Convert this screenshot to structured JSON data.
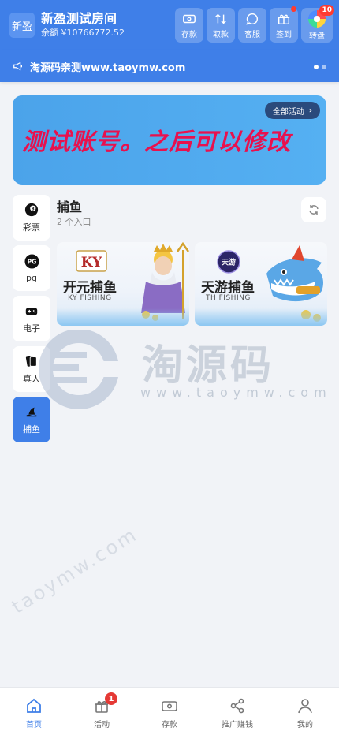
{
  "header": {
    "logo_text": "新盈",
    "room_name": "新盈测试房间",
    "balance": "余额 ¥10766772.52",
    "actions": [
      {
        "label": "存款",
        "icon": "deposit-icon"
      },
      {
        "label": "取款",
        "icon": "withdraw-icon"
      },
      {
        "label": "客服",
        "icon": "chat-icon"
      },
      {
        "label": "签到",
        "icon": "gift-icon"
      },
      {
        "label": "转盘",
        "icon": "wheel-icon",
        "badge": "10"
      }
    ]
  },
  "notice": {
    "text": "淘源码亲测www.taoymw.com",
    "icon": "megaphone-icon"
  },
  "banner": {
    "text": "测试账号。之后可以修改",
    "all_activities": "全部活动"
  },
  "categories": [
    {
      "label": "彩票",
      "icon": "billiard-ball-icon"
    },
    {
      "label": "pg",
      "icon": "pg-icon"
    },
    {
      "label": "电子",
      "icon": "gamepad-icon"
    },
    {
      "label": "真人",
      "icon": "cards-icon"
    },
    {
      "label": "捕鱼",
      "icon": "shark-fin-icon",
      "active": true
    }
  ],
  "section": {
    "title": "捕鱼",
    "subtitle": "2 个入口"
  },
  "games": [
    {
      "name": "开元捕鱼",
      "sub": "KY FISHING",
      "brand": "KY"
    },
    {
      "name": "天游捕鱼",
      "sub": "TH FISHING",
      "brand": "天游"
    }
  ],
  "watermark": {
    "brand": "淘源码",
    "url": "www.taoymw.com",
    "diagonal": "taoymw.com"
  },
  "bottom_nav": [
    {
      "label": "首页",
      "icon": "home-icon",
      "active": true
    },
    {
      "label": "活动",
      "icon": "gift-icon",
      "badge": "1"
    },
    {
      "label": "存款",
      "icon": "deposit-icon"
    },
    {
      "label": "推广赚钱",
      "icon": "share-icon"
    },
    {
      "label": "我的",
      "icon": "user-icon"
    }
  ],
  "colors": {
    "primary": "#3f7fe8",
    "banner_text": "#e8114e",
    "badge": "#ff3b30"
  }
}
